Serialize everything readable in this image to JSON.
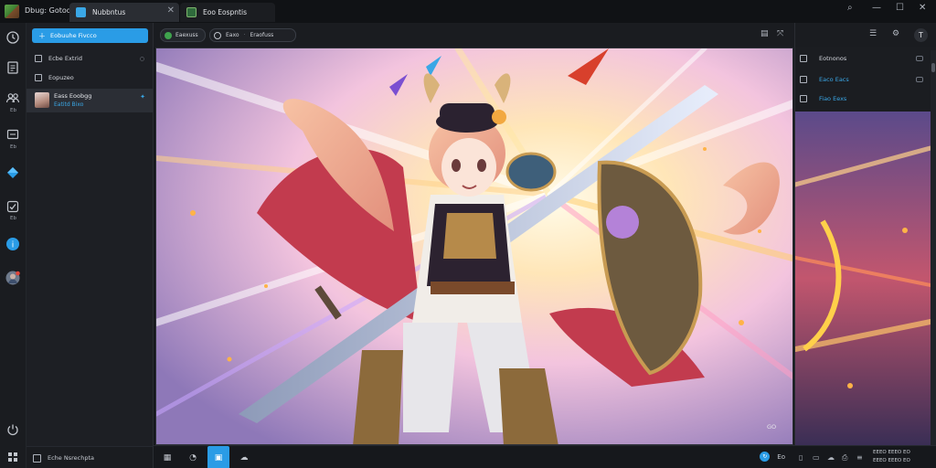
{
  "app": {
    "title": "Dbug: Gotod"
  },
  "tabs": [
    {
      "label": "Nubbntus",
      "active": true
    },
    {
      "label": "Eoo Eospntis",
      "active": false
    }
  ],
  "window": {
    "minimize": "—",
    "maximize": "☐",
    "close": "✕",
    "search": "⌕"
  },
  "rail": [
    {
      "icon": "clock-icon",
      "label": ""
    },
    {
      "icon": "document-icon",
      "label": ""
    },
    {
      "icon": "people-icon",
      "label": "Eb"
    },
    {
      "icon": "puzzle-icon",
      "label": "Eb"
    },
    {
      "icon": "diamond-icon",
      "label": ""
    },
    {
      "icon": "check-box-icon",
      "label": "Eb"
    },
    {
      "icon": "info-circle-icon",
      "label": ""
    },
    {
      "icon": "user-avatar-icon",
      "label": ""
    }
  ],
  "sidebar": {
    "new_button": "Eobuuhe Fivcco",
    "items": [
      {
        "label": "Ecbe Extrid",
        "count": "○"
      },
      {
        "label": "Eopuzeo",
        "count": ""
      }
    ],
    "session": {
      "name": "Eass Eoobgg",
      "sub": "Eatitd Bixo"
    },
    "footer": "Eche Nsrechpta"
  },
  "toolbar": {
    "chip1": "Eaexuss",
    "chip2_a": "Eaxo",
    "chip2_b": "Eraofuss"
  },
  "canvas": {
    "zoom_label": "GO"
  },
  "right_panel": {
    "rows": [
      {
        "label": "Eotnonos",
        "accent": false
      },
      {
        "label": "Eaco Eacs",
        "accent": true
      },
      {
        "label": "Fiao Eexs",
        "accent": true
      }
    ]
  },
  "bottom": {
    "right_glyph": "Eo"
  },
  "status": {
    "line1": "EEEO EEEO EO",
    "line2": "EEEO EEEO EO"
  }
}
